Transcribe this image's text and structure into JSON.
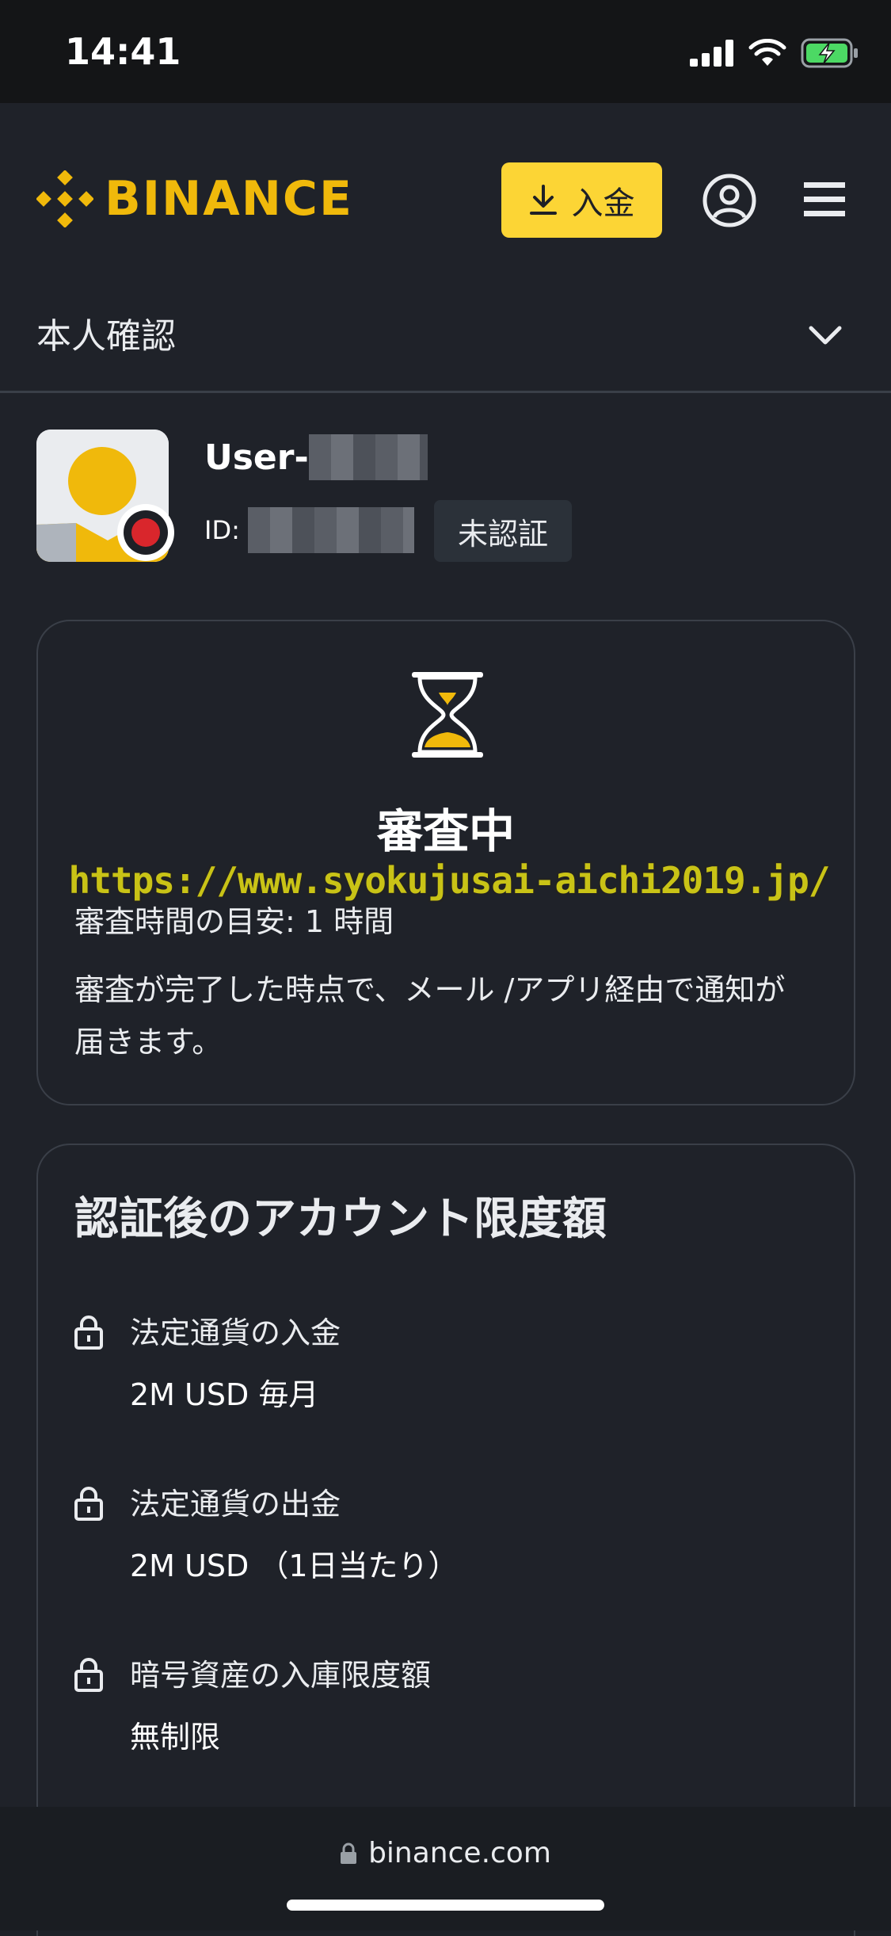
{
  "status_bar": {
    "time": "14:41"
  },
  "header": {
    "brand": "BINANCE",
    "deposit_label": "入金"
  },
  "section": {
    "title": "本人確認"
  },
  "user": {
    "name_prefix": "User-",
    "id_label": "ID:",
    "status_badge": "未認証"
  },
  "review_card": {
    "title": "審査中",
    "watermark": "https://www.syokujusai-aichi2019.jp/",
    "time_estimate": "審査時間の目安: 1 時間",
    "description": "審査が完了した時点で、メール /アプリ経由で通知が届きます。"
  },
  "limits_card": {
    "title": "認証後のアカウント限度額",
    "items": [
      {
        "label": "法定通貨の入金",
        "value": "2M USD 毎月"
      },
      {
        "label": "法定通貨の出金",
        "value": "2M USD （1日当たり）"
      },
      {
        "label": "暗号資産の入庫限度額",
        "value": "無制限"
      }
    ]
  },
  "browser": {
    "url": "binance.com"
  },
  "colors": {
    "brand": "#f0b90b",
    "button": "#fcd535",
    "background": "#1f2229",
    "badge_red": "#d9262c"
  }
}
